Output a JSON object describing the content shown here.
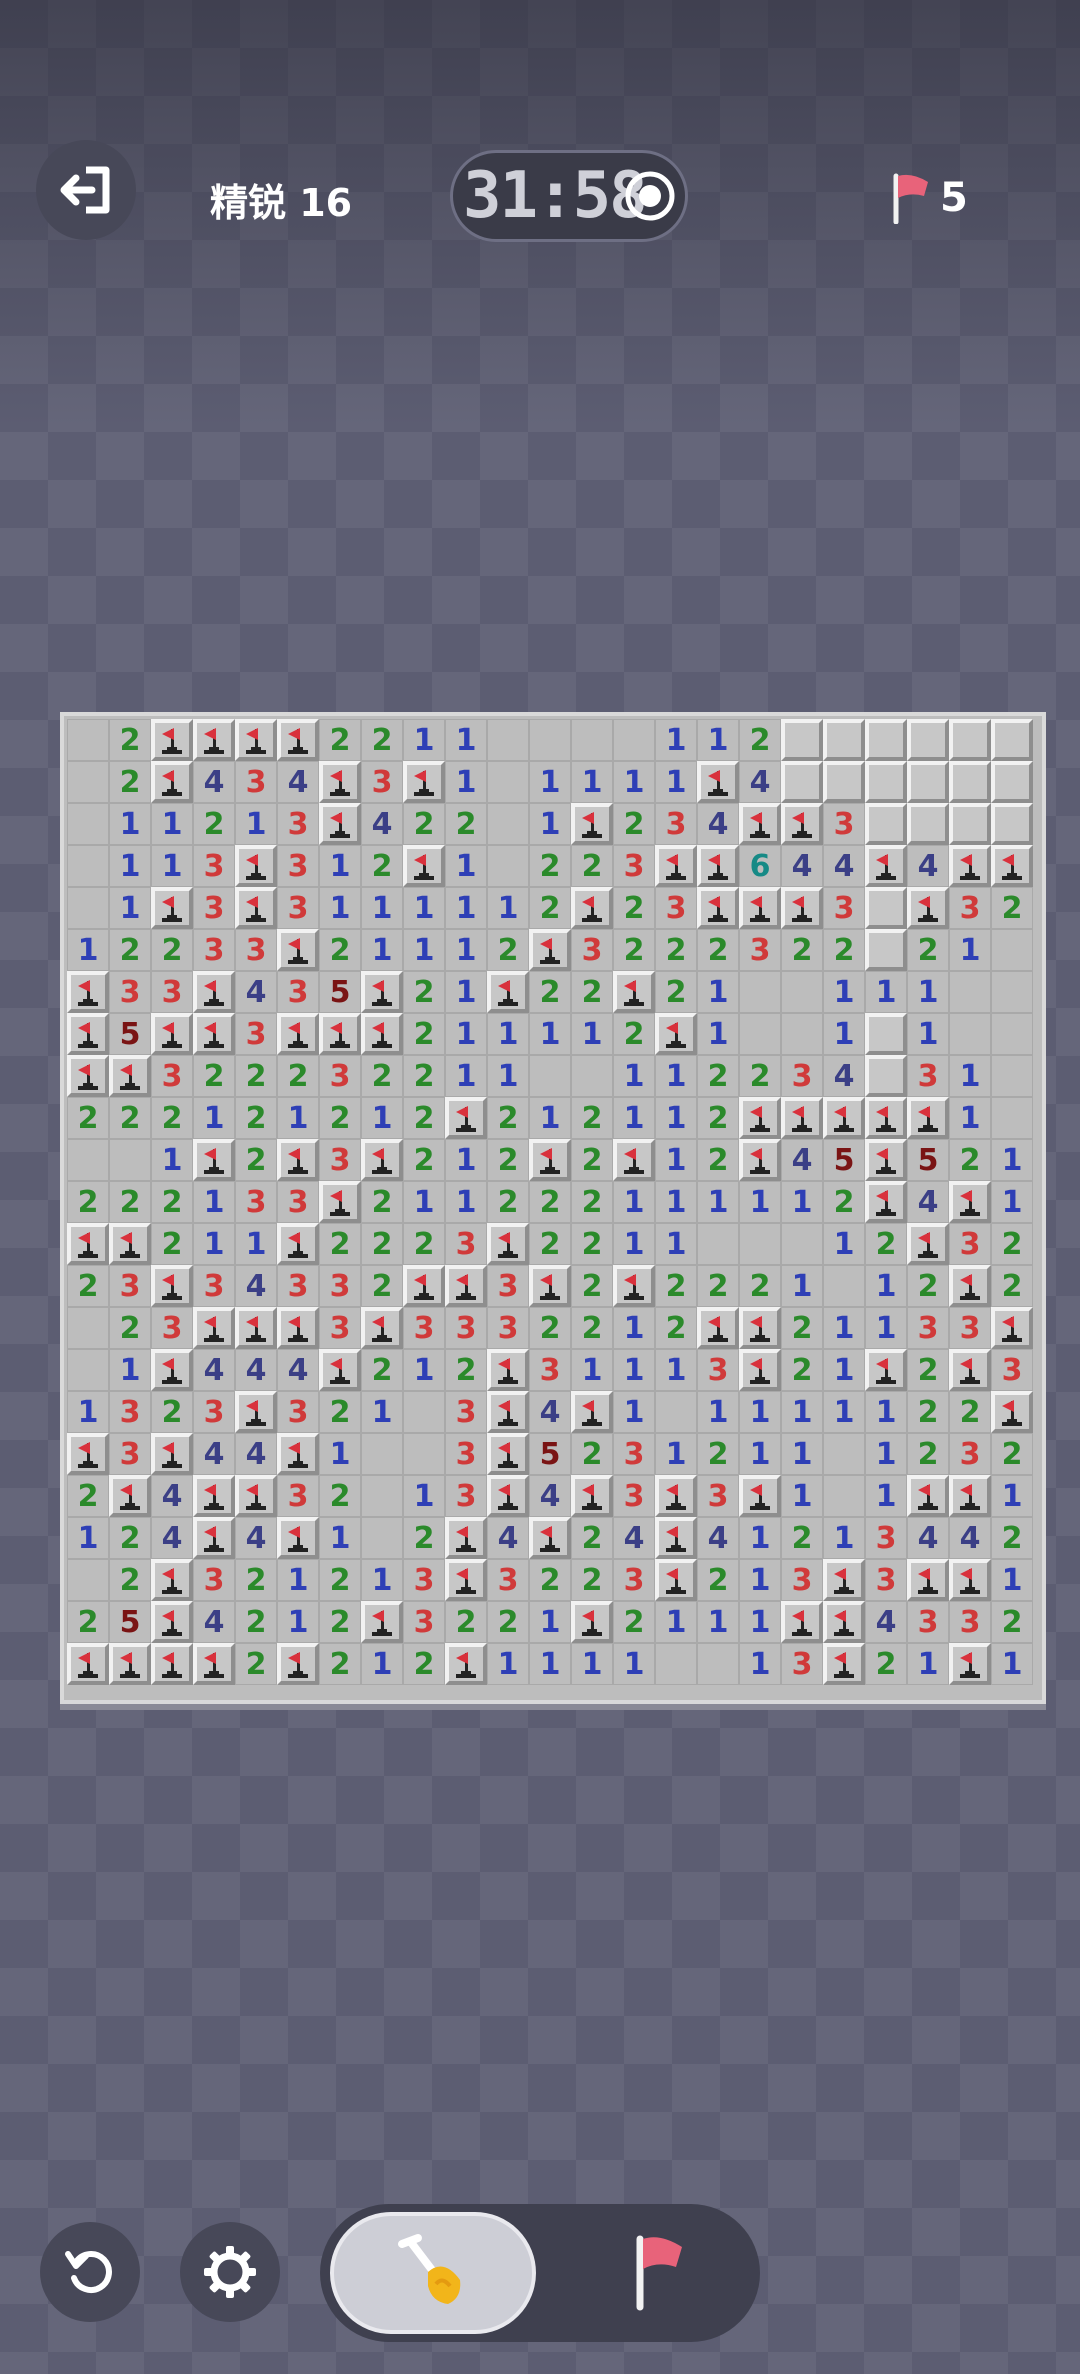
{
  "header": {
    "exit_icon": "exit-icon",
    "level_label": "精锐 16",
    "timer": "31:58",
    "record_icon": "record-icon",
    "flag_icon": "flag-icon",
    "flags_remaining": "5"
  },
  "board": {
    "columns": 23,
    "rows": 23,
    "legend": "N=number cell, . = revealed empty, F = flag, H = hidden",
    "grid": [
      ".,2,F,F,F,F,2,2,1,1,.,.,.,.,1,1,2,H,H,H,H,H,H",
      ".,2,F,4,3,4,F,3,F,1,.,1,1,1,1,F,4,H,H,H,H,H,H",
      ".,1,1,2,1,3,F,4,2,2,.,1,F,2,3,4,F,F,3,H,H,H,H",
      ".,1,1,3,F,3,1,2,F,1,.,2,2,3,F,F,6,4,4,F,4,F,F",
      ".,1,F,3,F,3,1,1,1,1,1,2,F,2,3,F,F,F,3,H,F,3,2",
      "1,2,2,3,3,F,2,1,1,1,2,F,3,2,2,2,3,2,2,H,2,1,.",
      "F,3,3,F,4,3,5,F,2,1,F,2,2,F,2,1,.,.,1,1,1,.,.",
      "F,5,F,F,3,F,F,F,2,1,1,1,1,2,F,1,.,.,1,H,1,.,.",
      "F,F,3,2,2,2,3,2,2,1,1,.,.,1,1,2,2,3,4,H,3,1,.",
      "2,2,2,1,2,1,2,1,2,F,2,1,2,1,1,2,F,F,F,F,F,1,.",
      ".,.,1,F,2,F,3,F,2,1,2,F,2,F,1,2,F,4,5,F,5,2,1",
      "2,2,2,1,3,3,F,2,1,1,2,2,2,1,1,1,1,1,2,F,4,F,1",
      "F,F,2,1,1,F,2,2,2,3,F,2,2,1,1,.,.,.,1,2,F,3,2",
      "2,3,F,3,4,3,3,2,F,F,3,F,2,F,2,2,2,1,.,1,2,F,2",
      ".,2,3,F,F,F,3,F,3,3,3,2,2,1,2,F,F,2,1,1,3,3,F",
      ".,1,F,4,4,4,F,2,1,2,F,3,1,1,1,3,F,2,1,F,2,F,3",
      "1,3,2,3,F,3,2,1,.,3,F,4,F,1,.,1,1,1,1,1,2,2,F",
      "F,3,F,4,4,F,1,.,.,3,F,5,2,3,1,2,1,1,.,1,2,3,2",
      "2,F,4,F,F,3,2,.,1,3,F,4,F,3,F,3,F,1,.,1,F,F,1",
      "1,2,4,F,4,F,1,.,2,F,4,F,2,4,F,4,1,2,1,3,4,4,2",
      ".,2,F,3,2,1,2,1,3,F,3,2,2,3,F,2,1,3,F,3,F,F,1",
      "2,5,F,4,2,1,2,F,3,2,2,1,F,2,1,1,1,F,F,4,3,3,2",
      "F,F,F,F,2,F,2,1,2,F,1,1,1,1,.,.,1,3,F,2,1,F,1"
    ]
  },
  "controls": {
    "undo_icon": "undo-icon",
    "settings_icon": "gear-icon",
    "dig_icon": "shovel-icon",
    "flag_mode_icon": "flag-icon",
    "active_mode": "dig"
  },
  "colors": {
    "n1": "#2e3fb6",
    "n2": "#2b8a2b",
    "n3": "#d03a3a",
    "n4": "#3b3f86",
    "n5": "#7a1414",
    "n6": "#168a86",
    "flag": "#d9313c"
  }
}
